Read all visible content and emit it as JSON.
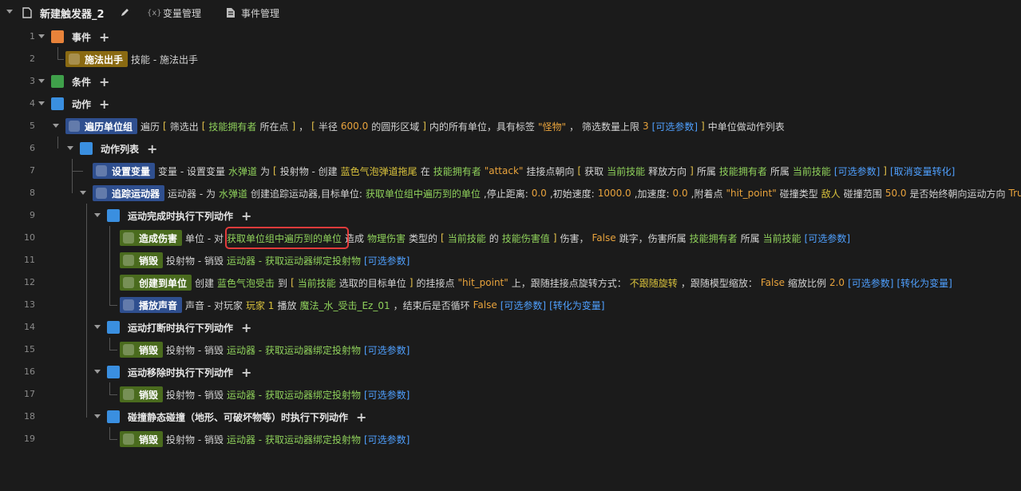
{
  "header": {
    "title": "新建触发器_2",
    "var_tab": "变量管理",
    "event_tab": "事件管理",
    "var_icon_glyph": "{x}"
  },
  "rows": [
    {
      "num": "1",
      "head": "事件",
      "kind": "section",
      "icon": "event-icon",
      "color": "#e8833a",
      "plus": true
    },
    {
      "num": "2",
      "head": "施法出手",
      "kind": "block",
      "color": "#8a6a12",
      "icon": "lightning-icon",
      "segs": [
        {
          "t": "技能 - 施法出手",
          "c": "w"
        }
      ]
    },
    {
      "num": "3",
      "head": "条件",
      "kind": "section",
      "icon": "condition-icon",
      "color": "#3fa04a",
      "plus": true
    },
    {
      "num": "4",
      "head": "动作",
      "kind": "section",
      "icon": "action-icon",
      "color": "#3a8fe0",
      "plus": true
    },
    {
      "num": "5",
      "head": "遍历单位组",
      "kind": "block",
      "color": "#2f4f8f",
      "icon": "loop-icon",
      "segs": [
        {
          "t": "遍历",
          "c": "w"
        },
        {
          "t": "[",
          "c": "bk"
        },
        {
          "t": "筛选出",
          "c": "w"
        },
        {
          "t": "[",
          "c": "bk"
        },
        {
          "t": "技能拥有者",
          "c": "g"
        },
        {
          "t": "所在点",
          "c": "w"
        },
        {
          "t": "]",
          "c": "bk"
        },
        {
          "t": "，",
          "c": "w"
        },
        {
          "t": "[",
          "c": "bk"
        },
        {
          "t": "半径",
          "c": "w"
        },
        {
          "t": "600.0",
          "c": "o"
        },
        {
          "t": "的圆形区域",
          "c": "w"
        },
        {
          "t": "]",
          "c": "bk"
        },
        {
          "t": "内的所有单位，具有标签",
          "c": "w"
        },
        {
          "t": "\"怪物\"",
          "c": "o"
        },
        {
          "t": "，",
          "c": "w"
        },
        {
          "t": "筛选数量上限",
          "c": "w"
        },
        {
          "t": "3",
          "c": "o"
        },
        {
          "t": "[可选参数]",
          "c": "b"
        },
        {
          "t": "]",
          "c": "bk"
        },
        {
          "t": "中单位做动作列表",
          "c": "w"
        }
      ]
    },
    {
      "num": "6",
      "head": "动作列表",
      "kind": "section",
      "icon": "action-list-icon",
      "color": "#3a8fe0",
      "plus": true
    },
    {
      "num": "7",
      "head": "设置变量",
      "kind": "block",
      "color": "#2f4f8f",
      "icon": "variable-icon",
      "segs": [
        {
          "t": "变量 - 设置变量",
          "c": "w"
        },
        {
          "t": "水弹道",
          "c": "g"
        },
        {
          "t": "为",
          "c": "w"
        },
        {
          "t": "[",
          "c": "bk"
        },
        {
          "t": "投射物 - 创建",
          "c": "w"
        },
        {
          "t": "蓝色气泡弹道拖尾",
          "c": "y"
        },
        {
          "t": "在",
          "c": "w"
        },
        {
          "t": "技能拥有者",
          "c": "g"
        },
        {
          "t": "\"attack\"",
          "c": "o"
        },
        {
          "t": "挂接点朝向",
          "c": "w"
        },
        {
          "t": "[",
          "c": "bk"
        },
        {
          "t": "获取",
          "c": "w"
        },
        {
          "t": "当前技能",
          "c": "g"
        },
        {
          "t": "释放方向",
          "c": "w"
        },
        {
          "t": "]",
          "c": "bk"
        },
        {
          "t": "所属",
          "c": "w"
        },
        {
          "t": "技能拥有者",
          "c": "g"
        },
        {
          "t": "所属",
          "c": "w"
        },
        {
          "t": "当前技能",
          "c": "g"
        },
        {
          "t": "[可选参数]",
          "c": "b"
        },
        {
          "t": "]",
          "c": "bk"
        },
        {
          "t": "[取消变量转化]",
          "c": "b"
        }
      ]
    },
    {
      "num": "8",
      "head": "追踪运动器",
      "kind": "block",
      "color": "#2f4f8f",
      "icon": "tracker-icon",
      "segs": [
        {
          "t": "运动器 - 为",
          "c": "w"
        },
        {
          "t": "水弹道",
          "c": "g"
        },
        {
          "t": "创建追踪运动器,目标单位:",
          "c": "w"
        },
        {
          "t": "获取单位组中遍历到的单位",
          "c": "g"
        },
        {
          "t": ",停止距离:",
          "c": "w"
        },
        {
          "t": "0.0",
          "c": "o"
        },
        {
          "t": ",初始速度:",
          "c": "w"
        },
        {
          "t": "1000.0",
          "c": "o"
        },
        {
          "t": ",加速度:",
          "c": "w"
        },
        {
          "t": "0.0",
          "c": "o"
        },
        {
          "t": ",附着点",
          "c": "w"
        },
        {
          "t": "\"hit_point\"",
          "c": "o"
        },
        {
          "t": "碰撞类型",
          "c": "w"
        },
        {
          "t": "敌人",
          "c": "y"
        },
        {
          "t": "碰撞范围",
          "c": "w"
        },
        {
          "t": "50.0",
          "c": "o"
        },
        {
          "t": "是否始终朝向运动方向",
          "c": "w"
        },
        {
          "t": "True",
          "c": "o"
        }
      ]
    },
    {
      "num": "9",
      "head": "运动完成时执行下列动作",
      "kind": "section",
      "icon": "action-list-icon",
      "color": "#3a8fe0",
      "plus": true
    },
    {
      "num": "10",
      "head": "造成伤害",
      "kind": "block",
      "color": "#4a6b1e",
      "icon": "unit-icon",
      "segs": [
        {
          "t": "单位 - 对",
          "c": "w"
        },
        {
          "t": "获取单位组中遍历到的单位",
          "c": "g"
        },
        {
          "t": "造成",
          "c": "w"
        },
        {
          "t": "物理伤害",
          "c": "g"
        },
        {
          "t": "类型的",
          "c": "w"
        },
        {
          "t": "[",
          "c": "bk"
        },
        {
          "t": "当前技能",
          "c": "g"
        },
        {
          "t": "的",
          "c": "w"
        },
        {
          "t": "技能伤害值",
          "c": "g"
        },
        {
          "t": "]",
          "c": "bk"
        },
        {
          "t": "伤害，",
          "c": "w"
        },
        {
          "t": "False",
          "c": "o"
        },
        {
          "t": "跳字，伤害所属",
          "c": "w"
        },
        {
          "t": "技能拥有者",
          "c": "g"
        },
        {
          "t": "所属",
          "c": "w"
        },
        {
          "t": "当前技能",
          "c": "g"
        },
        {
          "t": "[可选参数]",
          "c": "b"
        }
      ]
    },
    {
      "num": "11",
      "head": "销毁",
      "kind": "block",
      "color": "#4a6b1e",
      "icon": "projectile-icon",
      "segs": [
        {
          "t": "投射物 - 销毁",
          "c": "w"
        },
        {
          "t": "运动器 - 获取运动器绑定投射物",
          "c": "g"
        },
        {
          "t": "[可选参数]",
          "c": "b"
        }
      ]
    },
    {
      "num": "12",
      "head": "创建到单位",
      "kind": "block",
      "color": "#4a6b1e",
      "icon": "effect-icon",
      "segs": [
        {
          "t": "创建",
          "c": "w"
        },
        {
          "t": "蓝色气泡受击",
          "c": "g"
        },
        {
          "t": "到",
          "c": "w"
        },
        {
          "t": "[",
          "c": "bk"
        },
        {
          "t": "当前技能",
          "c": "g"
        },
        {
          "t": "选取的目标单位",
          "c": "w"
        },
        {
          "t": "]",
          "c": "bk"
        },
        {
          "t": "的挂接点",
          "c": "w"
        },
        {
          "t": "\"hit_point\"",
          "c": "o"
        },
        {
          "t": "上，跟随挂接点旋转方式：",
          "c": "w"
        },
        {
          "t": "不跟随旋转",
          "c": "y"
        },
        {
          "t": "，跟随模型缩放：",
          "c": "w"
        },
        {
          "t": "False",
          "c": "o"
        },
        {
          "t": "缩放比例",
          "c": "w"
        },
        {
          "t": "2.0",
          "c": "o"
        },
        {
          "t": "[可选参数]",
          "c": "b"
        },
        {
          "t": "[转化为变量]",
          "c": "b"
        }
      ]
    },
    {
      "num": "13",
      "head": "播放声音",
      "kind": "block",
      "color": "#2f4f8f",
      "icon": "sound-icon",
      "segs": [
        {
          "t": "声音 - 对玩家",
          "c": "w"
        },
        {
          "t": "玩家 1",
          "c": "y"
        },
        {
          "t": "播放",
          "c": "w"
        },
        {
          "t": "魔法_水_受击_Ez_01",
          "c": "g"
        },
        {
          "t": "，结束后是否循环",
          "c": "w"
        },
        {
          "t": "False",
          "c": "o"
        },
        {
          "t": "[可选参数]",
          "c": "b"
        },
        {
          "t": "[转化为变量]",
          "c": "b"
        }
      ]
    },
    {
      "num": "14",
      "head": "运动打断时执行下列动作",
      "kind": "section",
      "icon": "action-list-icon",
      "color": "#3a8fe0",
      "plus": true
    },
    {
      "num": "15",
      "head": "销毁",
      "kind": "block",
      "color": "#4a6b1e",
      "icon": "projectile-icon",
      "segs": [
        {
          "t": "投射物 - 销毁",
          "c": "w"
        },
        {
          "t": "运动器 - 获取运动器绑定投射物",
          "c": "g"
        },
        {
          "t": "[可选参数]",
          "c": "b"
        }
      ]
    },
    {
      "num": "16",
      "head": "运动移除时执行下列动作",
      "kind": "section",
      "icon": "action-list-icon",
      "color": "#3a8fe0",
      "plus": true
    },
    {
      "num": "17",
      "head": "销毁",
      "kind": "block",
      "color": "#4a6b1e",
      "icon": "projectile-icon",
      "segs": [
        {
          "t": "投射物 - 销毁",
          "c": "w"
        },
        {
          "t": "运动器 - 获取运动器绑定投射物",
          "c": "g"
        },
        {
          "t": "[可选参数]",
          "c": "b"
        }
      ]
    },
    {
      "num": "18",
      "head": "碰撞静态碰撞（地形、可破坏物等）时执行下列动作",
      "kind": "section",
      "icon": "action-list-icon",
      "color": "#3a8fe0",
      "plus": true
    },
    {
      "num": "19",
      "head": "销毁",
      "kind": "block",
      "color": "#4a6b1e",
      "icon": "projectile-icon",
      "segs": [
        {
          "t": "投射物 - 销毁",
          "c": "w"
        },
        {
          "t": "运动器 - 获取运动器绑定投射物",
          "c": "g"
        },
        {
          "t": "[可选参数]",
          "c": "b"
        }
      ]
    }
  ]
}
